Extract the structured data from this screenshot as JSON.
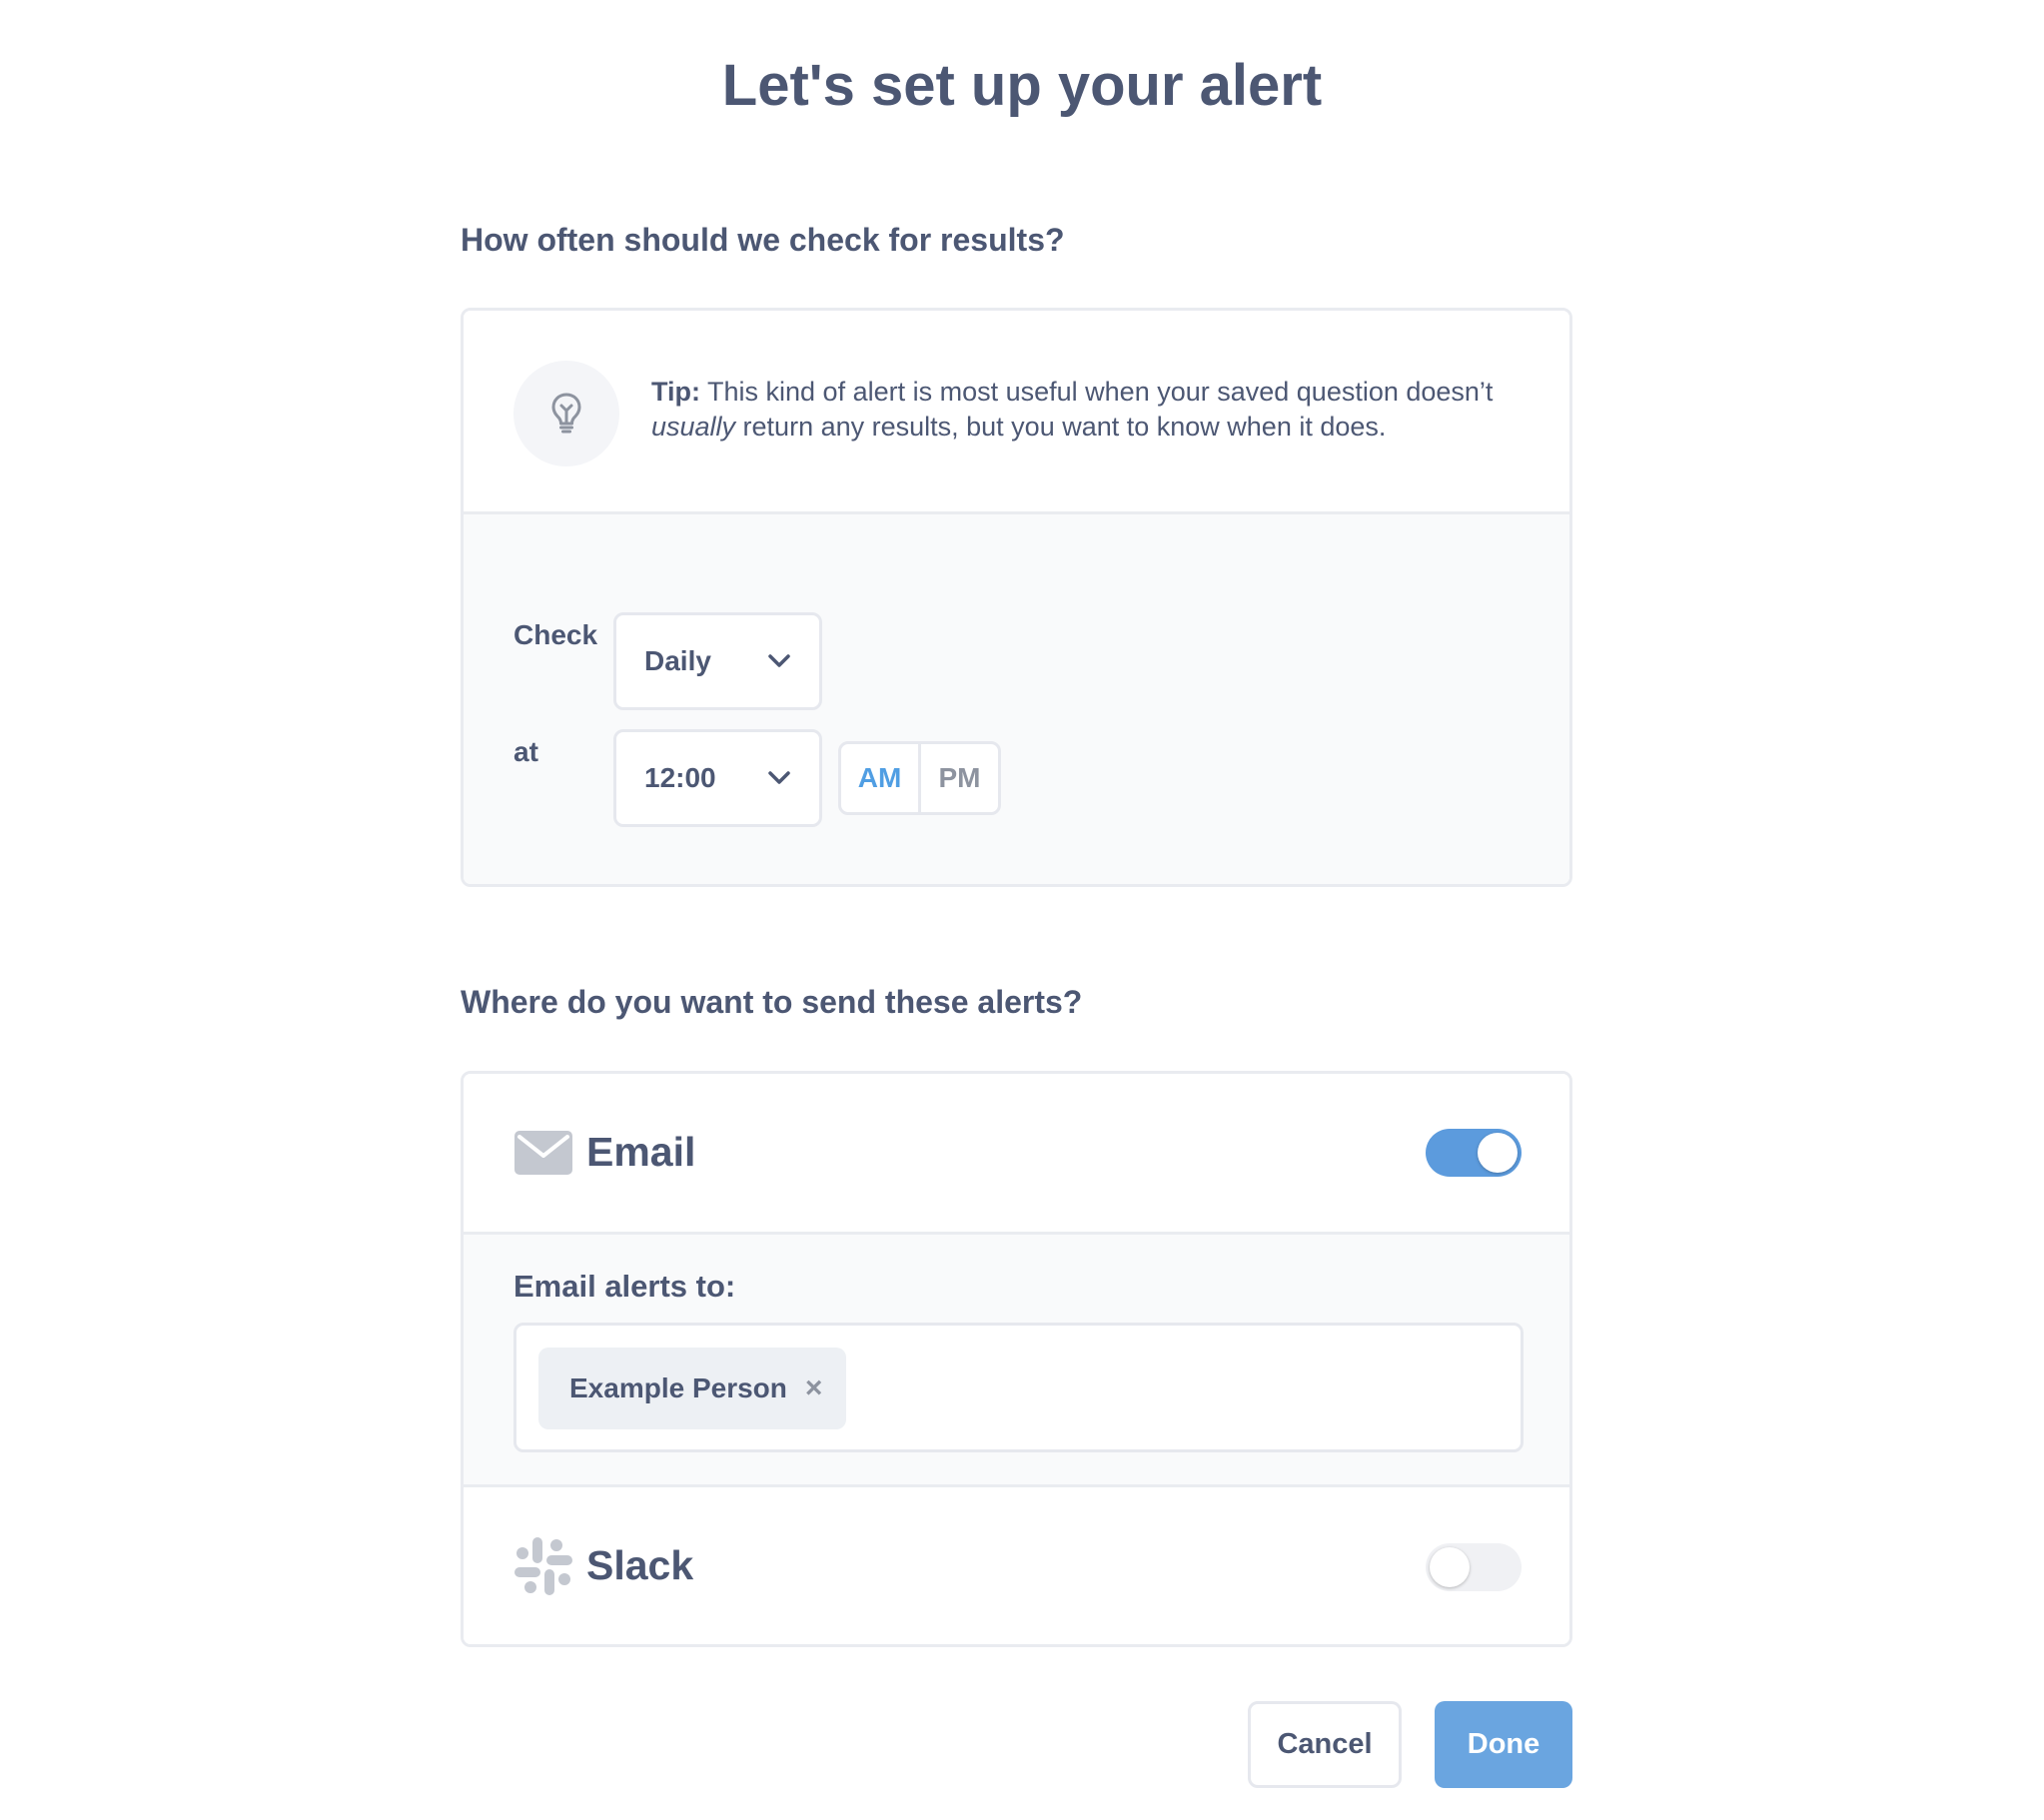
{
  "page": {
    "title": "Let's set up your alert"
  },
  "schedule": {
    "heading": "How often should we check for results?",
    "tip": {
      "label": "Tip:",
      "text_part1": " This kind of alert is most useful when your saved question doesn’t ",
      "emphasis": "usually",
      "text_part2": " return any results, but you want to know when it does.",
      "icon": "lightbulb-icon"
    },
    "check_label": "Check",
    "frequency": {
      "value": "Daily",
      "icon": "chevron-down-icon"
    },
    "at_label": "at",
    "time": {
      "value": "12:00",
      "icon": "chevron-down-icon"
    },
    "period": {
      "am": "AM",
      "pm": "PM",
      "selected": "AM"
    }
  },
  "channels": {
    "heading": "Where do you want to send these alerts?",
    "email": {
      "label": "Email",
      "icon": "mail-icon",
      "enabled": true,
      "recipients_label": "Email alerts to:",
      "recipients": [
        {
          "name": "Example Person"
        }
      ]
    },
    "slack": {
      "label": "Slack",
      "icon": "slack-icon",
      "enabled": false
    }
  },
  "actions": {
    "cancel_label": "Cancel",
    "done_label": "Done"
  },
  "colors": {
    "text": "#4c5773",
    "accent": "#509ee3",
    "primary_button": "#6aa5e0",
    "toggle_on": "#5c9bdd",
    "toggle_off": "#f0f1f4",
    "muted": "#8d939f"
  }
}
